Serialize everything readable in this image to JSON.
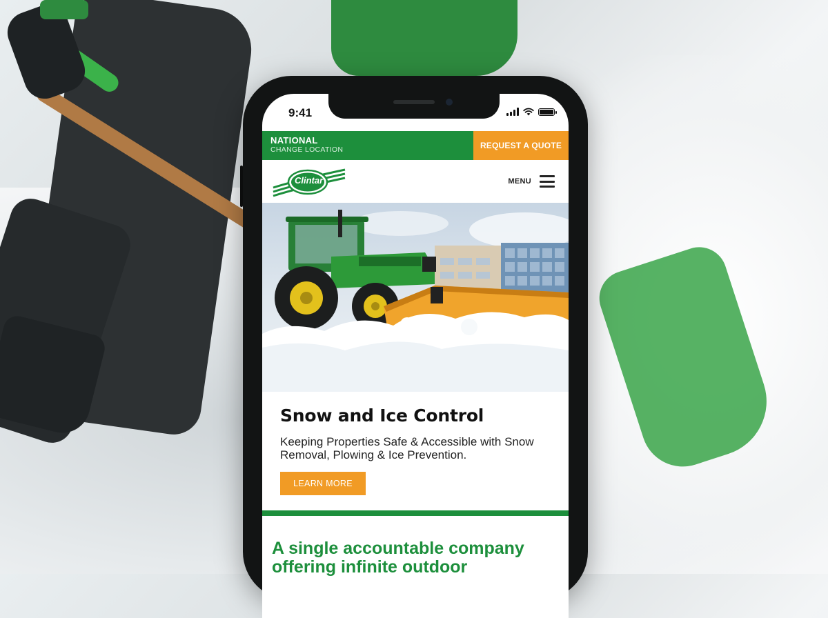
{
  "status": {
    "time": "9:41"
  },
  "topbar": {
    "location_name": "NATIONAL",
    "location_change": "CHANGE LOCATION",
    "quote_label": "REQUEST A QUOTE"
  },
  "header": {
    "logo_text": "Clintar",
    "menu_label": "MENU"
  },
  "hero": {
    "title": "Snow and Ice Control",
    "subtitle": "Keeping Properties Safe & Accessible with Snow Removal, Plowing & Ice Prevention.",
    "cta_label": "LEARN MORE"
  },
  "tagline": "A single accountable company offering infinite outdoor",
  "colors": {
    "brand_green": "#1d8f3c",
    "accent_orange": "#f19b25"
  },
  "icons": [
    "signal-icon",
    "wifi-icon",
    "battery-icon",
    "hamburger-menu-icon"
  ]
}
